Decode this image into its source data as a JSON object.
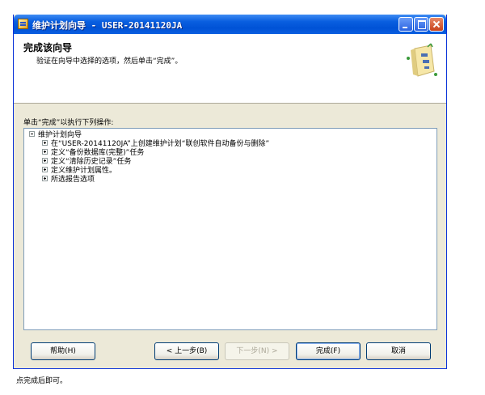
{
  "window": {
    "title": "维护计划向导 - USER-20141120JA"
  },
  "header": {
    "title": "完成该向导",
    "subtitle": "验证在向导中选择的选项，然后单击“完成”。"
  },
  "intro_text": "单击“完成”以执行下列操作:",
  "tree": {
    "root": "维护计划向导",
    "items": [
      "在“USER-20141120JA”上创建维护计划“联创软件自动备份与删除”",
      "定义“备份数据库(完整)”任务",
      "定义“清除历史记录”任务",
      "定义维护计划属性。",
      "所选报告选项"
    ]
  },
  "buttons": {
    "help": "帮助(H)",
    "back": "< 上一步(B)",
    "next": "下一步(N) >",
    "finish": "完成(F)",
    "cancel": "取消"
  },
  "footnote": "点完成后即可。",
  "colors": {
    "titlebar": "#0a5fe0",
    "window_bg": "#ece9d8",
    "close_button": "#c8421c"
  },
  "icons": [
    "app-icon",
    "minimize-icon",
    "maximize-icon",
    "close-icon",
    "wizard-graphic-icon",
    "tree-expander-icon"
  ]
}
